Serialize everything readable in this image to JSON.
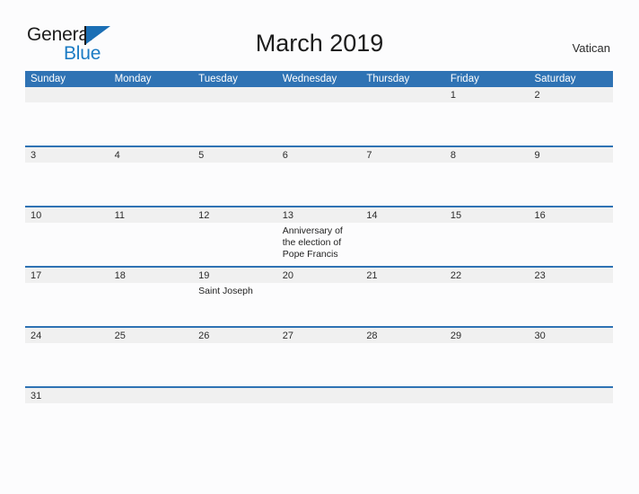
{
  "brand": {
    "name_part1": "General",
    "name_part2": "Blue",
    "flag_icon": "flag-triangle-icon",
    "color_black": "#1C1C1C",
    "color_blue": "#1B7BC4"
  },
  "header": {
    "title": "March 2019",
    "locale": "Vatican"
  },
  "colors": {
    "header_blue": "#2F73B4",
    "row_band_gray": "#F0F0F0",
    "page_background": "#FCFCFD",
    "text": "#222222"
  },
  "calendar": {
    "month": "March",
    "year": "2019",
    "weekdays": [
      "Sunday",
      "Monday",
      "Tuesday",
      "Wednesday",
      "Thursday",
      "Friday",
      "Saturday"
    ],
    "weeks": [
      {
        "days": [
          {
            "num": "",
            "events": []
          },
          {
            "num": "",
            "events": []
          },
          {
            "num": "",
            "events": []
          },
          {
            "num": "",
            "events": []
          },
          {
            "num": "",
            "events": []
          },
          {
            "num": "1",
            "events": []
          },
          {
            "num": "2",
            "events": []
          }
        ]
      },
      {
        "days": [
          {
            "num": "3",
            "events": []
          },
          {
            "num": "4",
            "events": []
          },
          {
            "num": "5",
            "events": []
          },
          {
            "num": "6",
            "events": []
          },
          {
            "num": "7",
            "events": []
          },
          {
            "num": "8",
            "events": []
          },
          {
            "num": "9",
            "events": []
          }
        ]
      },
      {
        "days": [
          {
            "num": "10",
            "events": []
          },
          {
            "num": "11",
            "events": []
          },
          {
            "num": "12",
            "events": []
          },
          {
            "num": "13",
            "events": [
              "Anniversary of the election of Pope Francis"
            ]
          },
          {
            "num": "14",
            "events": []
          },
          {
            "num": "15",
            "events": []
          },
          {
            "num": "16",
            "events": []
          }
        ]
      },
      {
        "days": [
          {
            "num": "17",
            "events": []
          },
          {
            "num": "18",
            "events": []
          },
          {
            "num": "19",
            "events": [
              "Saint Joseph"
            ]
          },
          {
            "num": "20",
            "events": []
          },
          {
            "num": "21",
            "events": []
          },
          {
            "num": "22",
            "events": []
          },
          {
            "num": "23",
            "events": []
          }
        ]
      },
      {
        "days": [
          {
            "num": "24",
            "events": []
          },
          {
            "num": "25",
            "events": []
          },
          {
            "num": "26",
            "events": []
          },
          {
            "num": "27",
            "events": []
          },
          {
            "num": "28",
            "events": []
          },
          {
            "num": "29",
            "events": []
          },
          {
            "num": "30",
            "events": []
          }
        ]
      },
      {
        "days": [
          {
            "num": "31",
            "events": []
          },
          {
            "num": "",
            "events": []
          },
          {
            "num": "",
            "events": []
          },
          {
            "num": "",
            "events": []
          },
          {
            "num": "",
            "events": []
          },
          {
            "num": "",
            "events": []
          },
          {
            "num": "",
            "events": []
          }
        ]
      }
    ]
  }
}
